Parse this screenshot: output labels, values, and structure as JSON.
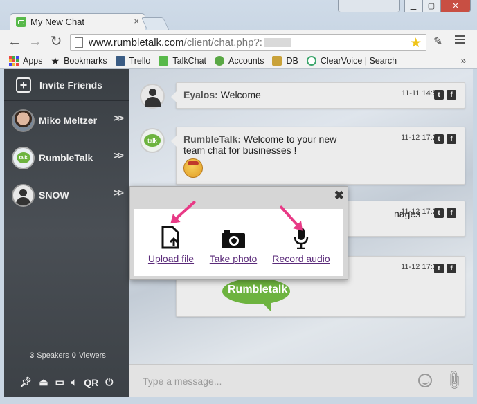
{
  "browser": {
    "tab_title": "My New Chat",
    "url_host": "www.rumbletalk.com",
    "url_path": "/client/chat.php?:",
    "bookmarks": [
      "Apps",
      "Bookmarks",
      "Trello",
      "TalkChat",
      "Accounts",
      "DB",
      "ClearVoice | Search"
    ],
    "more": "»"
  },
  "sidebar": {
    "invite_label": "Invite Friends",
    "contacts": [
      {
        "name": "Miko Meltzer"
      },
      {
        "name": "RumbleTalk"
      },
      {
        "name": "SNOW"
      }
    ],
    "stats": {
      "speakers_count": "3",
      "speakers_label": "Speakers",
      "viewers_count": "0",
      "viewers_label": "Viewers"
    },
    "tools_qr": "QR"
  },
  "messages": [
    {
      "sender": "Eyalos:",
      "text": " Welcome",
      "time": "11-11 14:59"
    },
    {
      "sender": "RumbleTalk:",
      "text": " Welcome to your new team chat for businesses !",
      "time": "11-12 17:28"
    },
    {
      "text_tail": "nages",
      "time": "11-12 17:28"
    },
    {
      "time": "11-12 17:33",
      "logo_text": "Rumbletalk"
    }
  ],
  "composer": {
    "placeholder": "Type a message..."
  },
  "popup": {
    "upload_label": "Upload file",
    "photo_label": "Take photo",
    "audio_label": "Record audio"
  },
  "colors": {
    "accent_arrow": "#e83a86",
    "link": "#5b2b7a",
    "sidebar_bg": "#3a3f44"
  }
}
